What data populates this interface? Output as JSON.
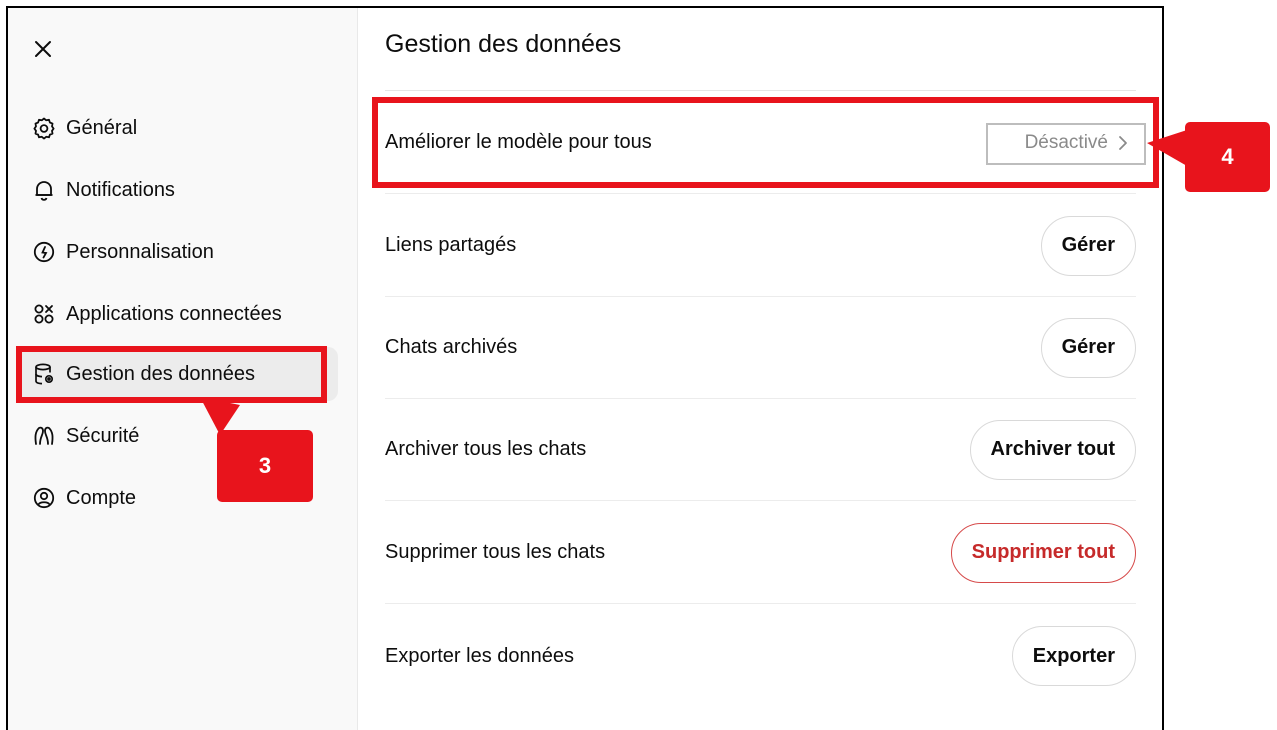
{
  "sidebar": {
    "close_icon": "close-icon",
    "items": [
      {
        "label": "Général",
        "icon": "gear-icon"
      },
      {
        "label": "Notifications",
        "icon": "bell-icon"
      },
      {
        "label": "Personnalisation",
        "icon": "personalization-icon"
      },
      {
        "label": "Applications connectées",
        "icon": "apps-icon"
      },
      {
        "label": "Gestion des données",
        "icon": "database-icon",
        "active": true
      },
      {
        "label": "Sécurité",
        "icon": "security-icon"
      },
      {
        "label": "Compte",
        "icon": "account-icon"
      }
    ]
  },
  "main": {
    "title": "Gestion des données",
    "rows": [
      {
        "label": "Améliorer le modèle pour tous",
        "value": "Désactivé"
      },
      {
        "label": "Liens partagés",
        "button": "Gérer"
      },
      {
        "label": "Chats archivés",
        "button": "Gérer"
      },
      {
        "label": "Archiver tous les chats",
        "button": "Archiver tout"
      },
      {
        "label": "Supprimer tous les chats",
        "button": "Supprimer tout"
      },
      {
        "label": "Exporter les données",
        "button": "Exporter"
      }
    ]
  },
  "annotations": {
    "step3": "3",
    "step4": "4",
    "color": "#e8141c"
  }
}
